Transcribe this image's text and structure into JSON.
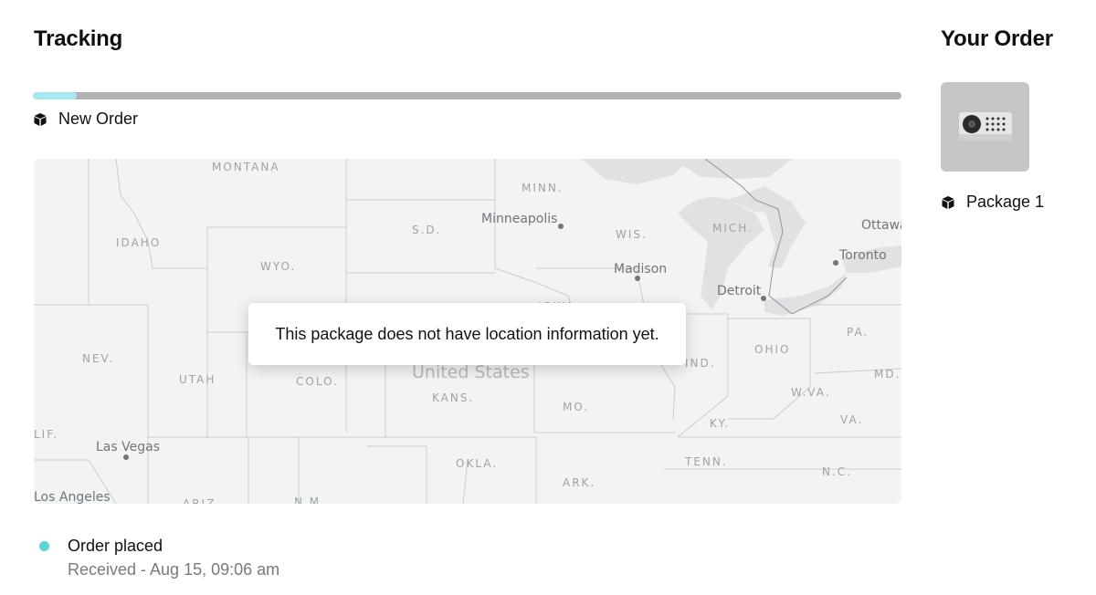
{
  "tracking": {
    "title": "Tracking",
    "progress_percent": 5,
    "progress_color": "#a7e9f1",
    "status_label": "New Order",
    "status_icon": "package-icon"
  },
  "map": {
    "notice": "This package does not have location information yet.",
    "country_label": "United States",
    "state_labels": [
      "MONTANA",
      "IDAHO",
      "WYO.",
      "NEV.",
      "UTAH",
      "COLO.",
      "KANS.",
      "OKLA.",
      "MO.",
      "ARK.",
      "TENN.",
      "KY.",
      "IND.",
      "OHIO",
      "W.VA.",
      "VA.",
      "N.C.",
      "PA.",
      "MD.",
      "MINN.",
      "WIS.",
      "MICH.",
      "S.D.",
      "LIF.",
      "ARIZ.",
      "N.M.",
      "IOWA"
    ],
    "cities": [
      "Minneapolis",
      "Madison",
      "Detroit",
      "Toronto",
      "Ottawa",
      "Las Vegas",
      "Los Angeles"
    ]
  },
  "timeline": {
    "events": [
      {
        "title": "Order placed",
        "subtitle": "Received - Aug 15, 09:06 am",
        "dot_color": "#5dd4d4"
      }
    ]
  },
  "order": {
    "title": "Your Order",
    "package_label": "Package 1",
    "package_icon": "package-icon"
  }
}
